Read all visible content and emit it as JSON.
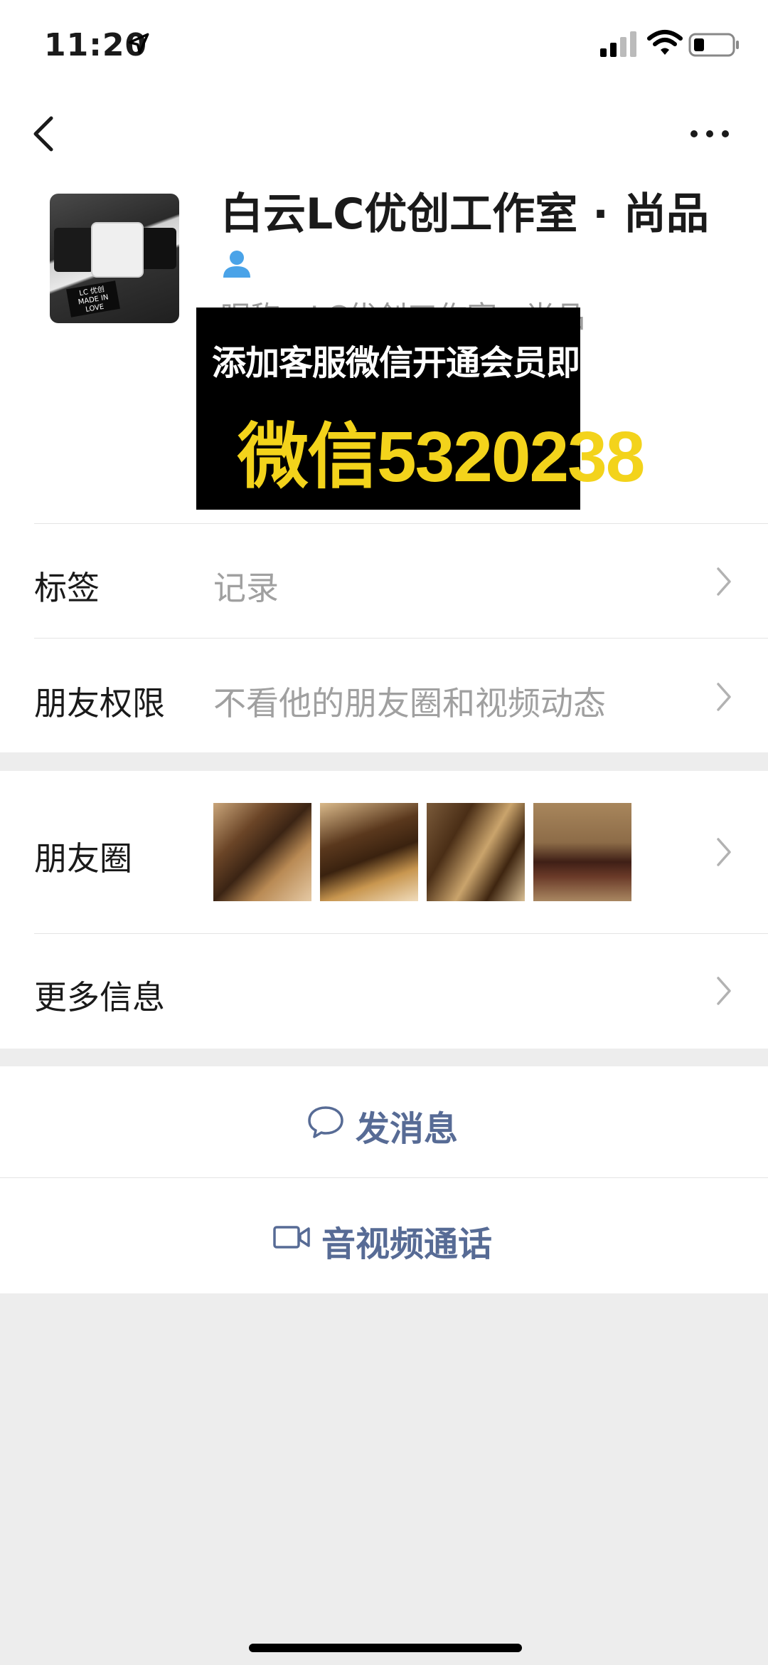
{
  "status_bar": {
    "time": "11:20"
  },
  "profile": {
    "name": "白云LC优创工作室 · 尚品",
    "nickname": "昵称：LC优创工作室 · 尚品",
    "promo_line1": "添加客服微信开通会员即可查看",
    "promo_line2": "微信5320238"
  },
  "rows": {
    "tags_label": "标签",
    "tags_value": "记录",
    "permission_label": "朋友权限",
    "permission_value": "不看他的朋友圈和视频动态",
    "moments_label": "朋友圈",
    "more_info_label": "更多信息"
  },
  "actions": {
    "send_message": "发消息",
    "video_call": "音视频通话"
  },
  "colors": {
    "link_blue": "#576b95",
    "promo_yellow": "#f3d31b",
    "background_gray": "#ededed"
  }
}
